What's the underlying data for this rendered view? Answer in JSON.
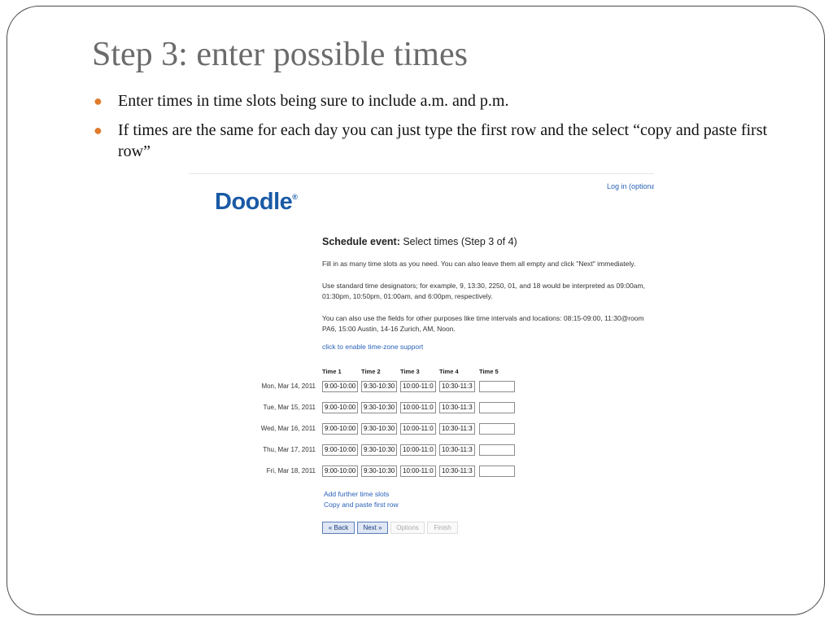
{
  "slide": {
    "title": "Step 3: enter possible times",
    "bullets": [
      "Enter times in time slots being sure to include a.m. and p.m.",
      "If times are the same for each day you can just type the first row and the select “copy and paste first row”"
    ],
    "bullet_color": "#e07b2c"
  },
  "doodle": {
    "login_link": "Log in (optiona",
    "logo_text": "Doodle",
    "logo_mark": "®",
    "heading_bold": "Schedule event:",
    "heading_rest": " Select times (Step 3 of 4)",
    "para1": "Fill in as many time slots as you need. You can also leave them all empty and click \"Next\" immediately.",
    "para2": "Use standard time designators; for example, 9, 13:30, 2250, 01, and 18 would be interpreted as 09:00am, 01:30pm, 10:50pm, 01:00am, and 6:00pm, respectively.",
    "para3": "You can also use the fields for other purposes like time intervals and locations: 08:15-09:00, 11:30@room PA6, 15:00 Austin, 14-16 Zurich, AM, Noon.",
    "timezone_link": "click to enable time-zone support",
    "columns": [
      "Time 1",
      "Time 2",
      "Time 3",
      "Time 4",
      "Time 5"
    ],
    "rows": [
      {
        "date": "Mon, Mar 14, 2011",
        "slots": [
          "9:00-10:00",
          "9:30-10:30",
          "10:00-11:0",
          "10:30-11:3",
          ""
        ]
      },
      {
        "date": "Tue, Mar 15, 2011",
        "slots": [
          "9:00-10:00",
          "9:30-10:30",
          "10:00-11:0",
          "10:30-11:3",
          ""
        ]
      },
      {
        "date": "Wed, Mar 16, 2011",
        "slots": [
          "9:00-10:00",
          "9:30-10:30",
          "10:00-11:0",
          "10:30-11:3",
          ""
        ]
      },
      {
        "date": "Thu, Mar 17, 2011",
        "slots": [
          "9:00-10:00",
          "9:30-10:30",
          "10:00-11:0",
          "10:30-11:3",
          ""
        ]
      },
      {
        "date": "Fri, Mar 18, 2011",
        "slots": [
          "9:00-10:00",
          "9:30-10:30",
          "10:00-11:0",
          "10:30-11:3",
          ""
        ]
      }
    ],
    "add_slots_link": "Add further time slots",
    "copy_row_link": "Copy and paste first row",
    "buttons": {
      "back": "« Back",
      "next": "Next »",
      "options": "Options",
      "finish": "Finish"
    },
    "brand_color": "#1a5aa6",
    "link_color": "#2a62b8"
  }
}
